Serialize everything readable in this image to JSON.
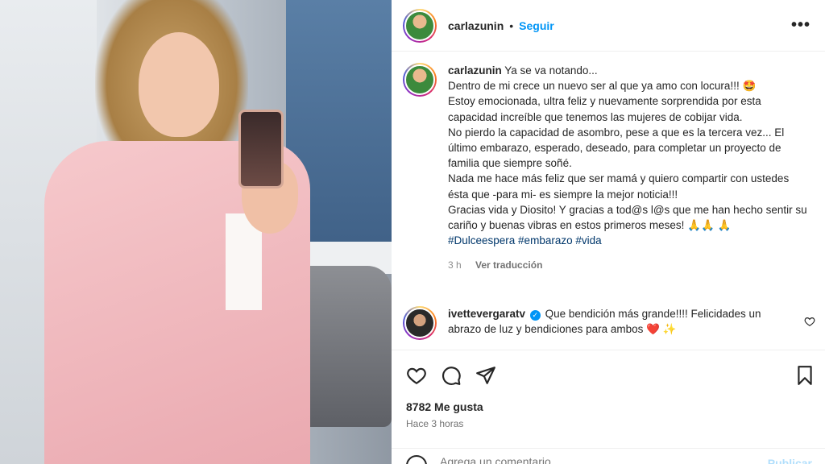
{
  "post": {
    "username": "carlazunin",
    "separator": "•",
    "follow_label": "Seguir",
    "more_label": "•••"
  },
  "caption": {
    "username": "carlazunin",
    "lines": [
      "Ya se va notando...",
      "Dentro de mi crece un nuevo ser al que ya amo con locura!!! 🤩",
      "Estoy emocionada, ultra feliz y nuevamente sorprendida por esta capacidad increíble que tenemos las mujeres de cobijar vida.",
      "No pierdo la capacidad de asombro, pese a que es la tercera vez... El último embarazo, esperado, deseado, para completar un proyecto de familia que siempre soñé.",
      "Nada me hace más feliz que ser mamá y quiero compartir con ustedes ésta que -para mi- es siempre la mejor noticia!!!",
      "Gracias vida y Diosito! Y gracias a tod@s l@s que me han hecho sentir su cariño y buenas vibras en estos primeros meses! 🙏🙏 🙏"
    ],
    "hashtags": "#Dulceespera #embarazo #vida",
    "age": "3 h",
    "translate_label": "Ver traducción"
  },
  "comment": {
    "username": "ivettevergaratv",
    "verified_glyph": "✓",
    "text": "Que bendición más grande!!!! Felicidades un abrazo de luz y bendiciones para ambos ❤️ ✨"
  },
  "stats": {
    "likes": "8782 Me gusta",
    "time": "Hace 3 horas"
  },
  "add_comment": {
    "placeholder": "Agrega un comentario...",
    "publish_label": "Publicar"
  },
  "colors": {
    "accent": "#0095f6",
    "hashtag": "#00376b",
    "like_heart": "#ed4956"
  }
}
